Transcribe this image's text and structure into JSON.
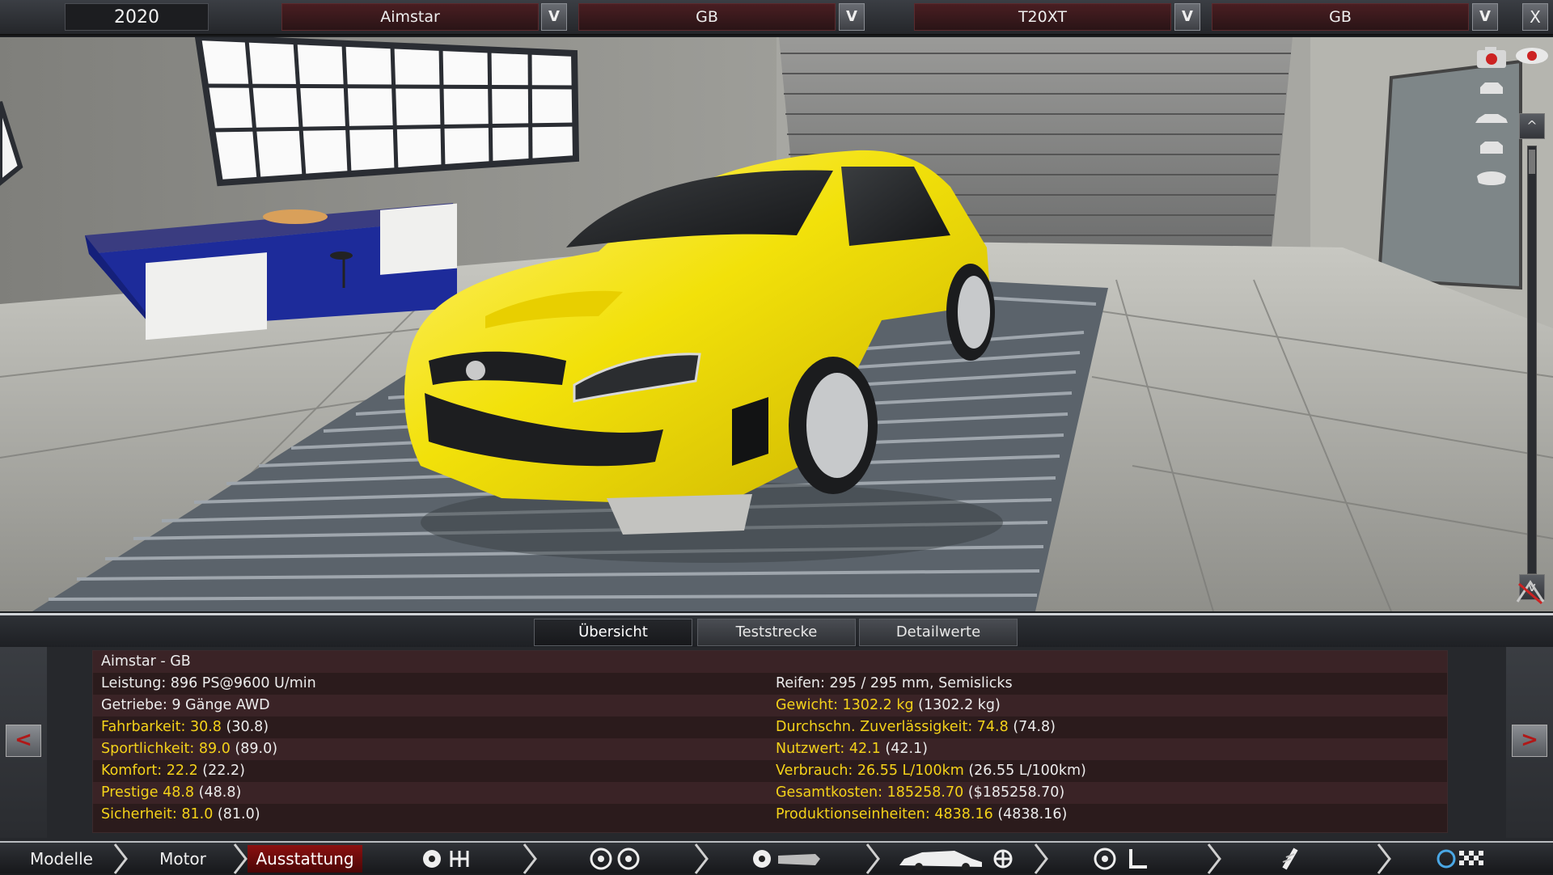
{
  "top_bar": {
    "year": "2020",
    "model_select": {
      "value": "Aimstar"
    },
    "trim_select": {
      "value": "GB"
    },
    "engine_select": {
      "value": "T20XT"
    },
    "engine_trim_select": {
      "value": "GB"
    },
    "dropdown_glyph": "V",
    "close_glyph": "X"
  },
  "viewport": {
    "scroll_up_glyph": "^",
    "scroll_down_glyph": "v",
    "car_color": "#f2e10a"
  },
  "tabs": [
    {
      "label": "Übersicht",
      "active": true
    },
    {
      "label": "Teststrecke",
      "active": false
    },
    {
      "label": "Detailwerte",
      "active": false
    }
  ],
  "nav": {
    "prev": "<",
    "next": ">"
  },
  "info": {
    "title": "Aimstar - GB",
    "left": [
      {
        "label": "Leistung: 896 PS@9600 U/min",
        "extra": ""
      },
      {
        "label": "Getriebe: 9 Gänge AWD",
        "extra": ""
      },
      {
        "label": "Fahrbarkeit: 30.8",
        "extra": "(30.8)"
      },
      {
        "label": "Sportlichkeit: 89.0",
        "extra": "(89.0)"
      },
      {
        "label": "Komfort: 22.2",
        "extra": "(22.2)"
      },
      {
        "label": "Prestige 48.8",
        "extra": "(48.8)"
      },
      {
        "label": "Sicherheit: 81.0",
        "extra": "(81.0)"
      }
    ],
    "right": [
      {
        "label": "Reifen: 295 / 295 mm, Semislicks",
        "extra": ""
      },
      {
        "label": "Gewicht: 1302.2 kg",
        "extra": "(1302.2 kg)"
      },
      {
        "label": "Durchschn. Zuverlässigkeit: 74.8",
        "extra": "(74.8)"
      },
      {
        "label": "Nutzwert: 42.1",
        "extra": "(42.1)"
      },
      {
        "label": "Verbrauch: 26.55 L/100km",
        "extra": "(26.55 L/100km)"
      },
      {
        "label": "Gesamtkosten: 185258.70",
        "extra": "($185258.70)"
      },
      {
        "label": "Produktionseinheiten: 4838.16",
        "extra": "(4838.16)"
      }
    ],
    "highlight_color": "#f4d21a"
  },
  "bottom_nav": {
    "modelle": "Modelle",
    "motor": "Motor",
    "ausstattung": "Ausstattung",
    "active_color": "#8b1010"
  }
}
